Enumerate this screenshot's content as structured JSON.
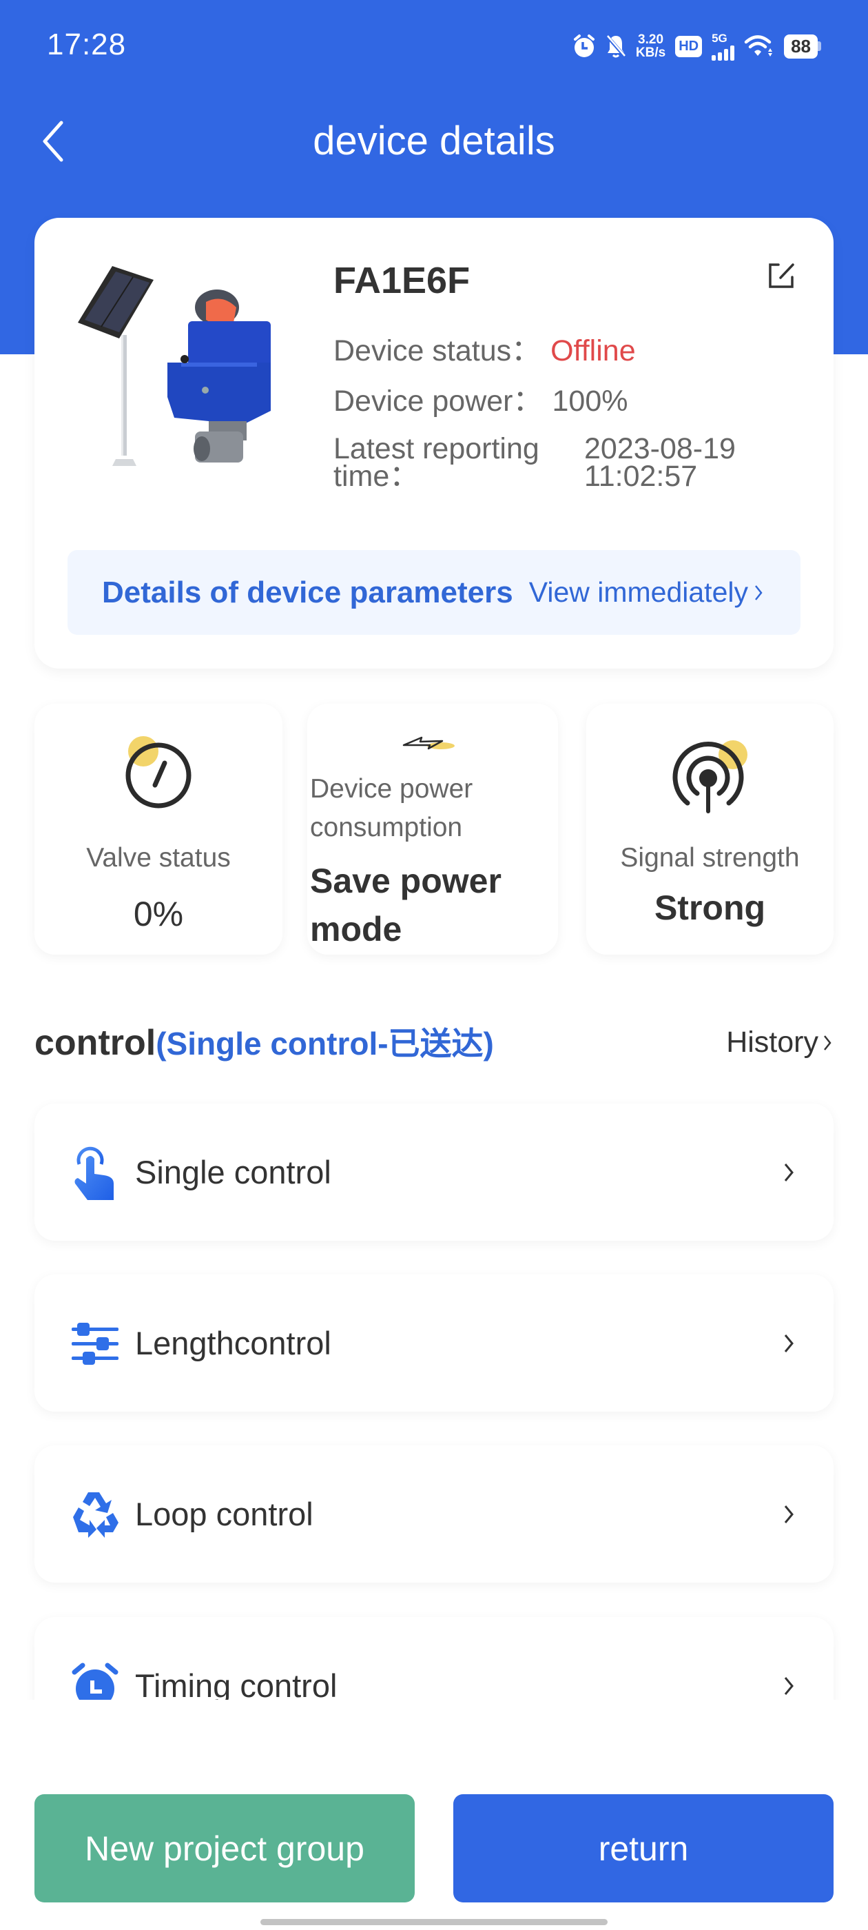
{
  "status_bar": {
    "time": "17:28",
    "net_speed_value": "3.20",
    "net_speed_unit": "KB/s",
    "hd_label": "HD",
    "network_type": "5G",
    "battery_level": "88",
    "icons": [
      "alarm-icon",
      "mute-bell-icon",
      "hd-icon",
      "cellular-signal-icon",
      "wifi-icon",
      "battery-icon"
    ]
  },
  "header": {
    "title": "device  details",
    "back_icon": "chevron-left-icon"
  },
  "device": {
    "name": "FA1E6F",
    "status_label": "Device status：",
    "status_value": "Offline",
    "power_label": "Device power：",
    "power_value": "100%",
    "latest_label": "Latest reporting time：",
    "latest_date": "2023-08-19",
    "latest_time": "11:02:57",
    "edit_icon": "edit-icon",
    "status_color": "#e0494a"
  },
  "params_banner": {
    "title": "Details of device parameters",
    "link": "View immediately",
    "chevron": "›"
  },
  "stats": [
    {
      "label": "Valve status",
      "value": "0%",
      "icon": "gauge-icon"
    },
    {
      "label": "Device power consumption",
      "value": "Save power mode",
      "icon": "lightning-icon"
    },
    {
      "label": "Signal strength",
      "value": "Strong",
      "icon": "broadcast-signal-icon"
    }
  ],
  "control": {
    "title": "control",
    "subtitle": "(Single control-已送达)",
    "history_label": "History",
    "items": [
      {
        "label": "Single control",
        "icon": "tap-finger-icon"
      },
      {
        "label": "Lengthcontrol",
        "icon": "sliders-icon"
      },
      {
        "label": "Loop control",
        "icon": "recycle-icon"
      },
      {
        "label": "Timing control",
        "icon": "alarm-clock-icon"
      }
    ]
  },
  "buttons": {
    "new_group": "New project group",
    "return": "return"
  },
  "colors": {
    "primary": "#3167e3",
    "accent_text": "#3167d6",
    "green_button": "#5ab394",
    "offline_red": "#e0494a",
    "highlight_yellow": "#f2d46a"
  }
}
